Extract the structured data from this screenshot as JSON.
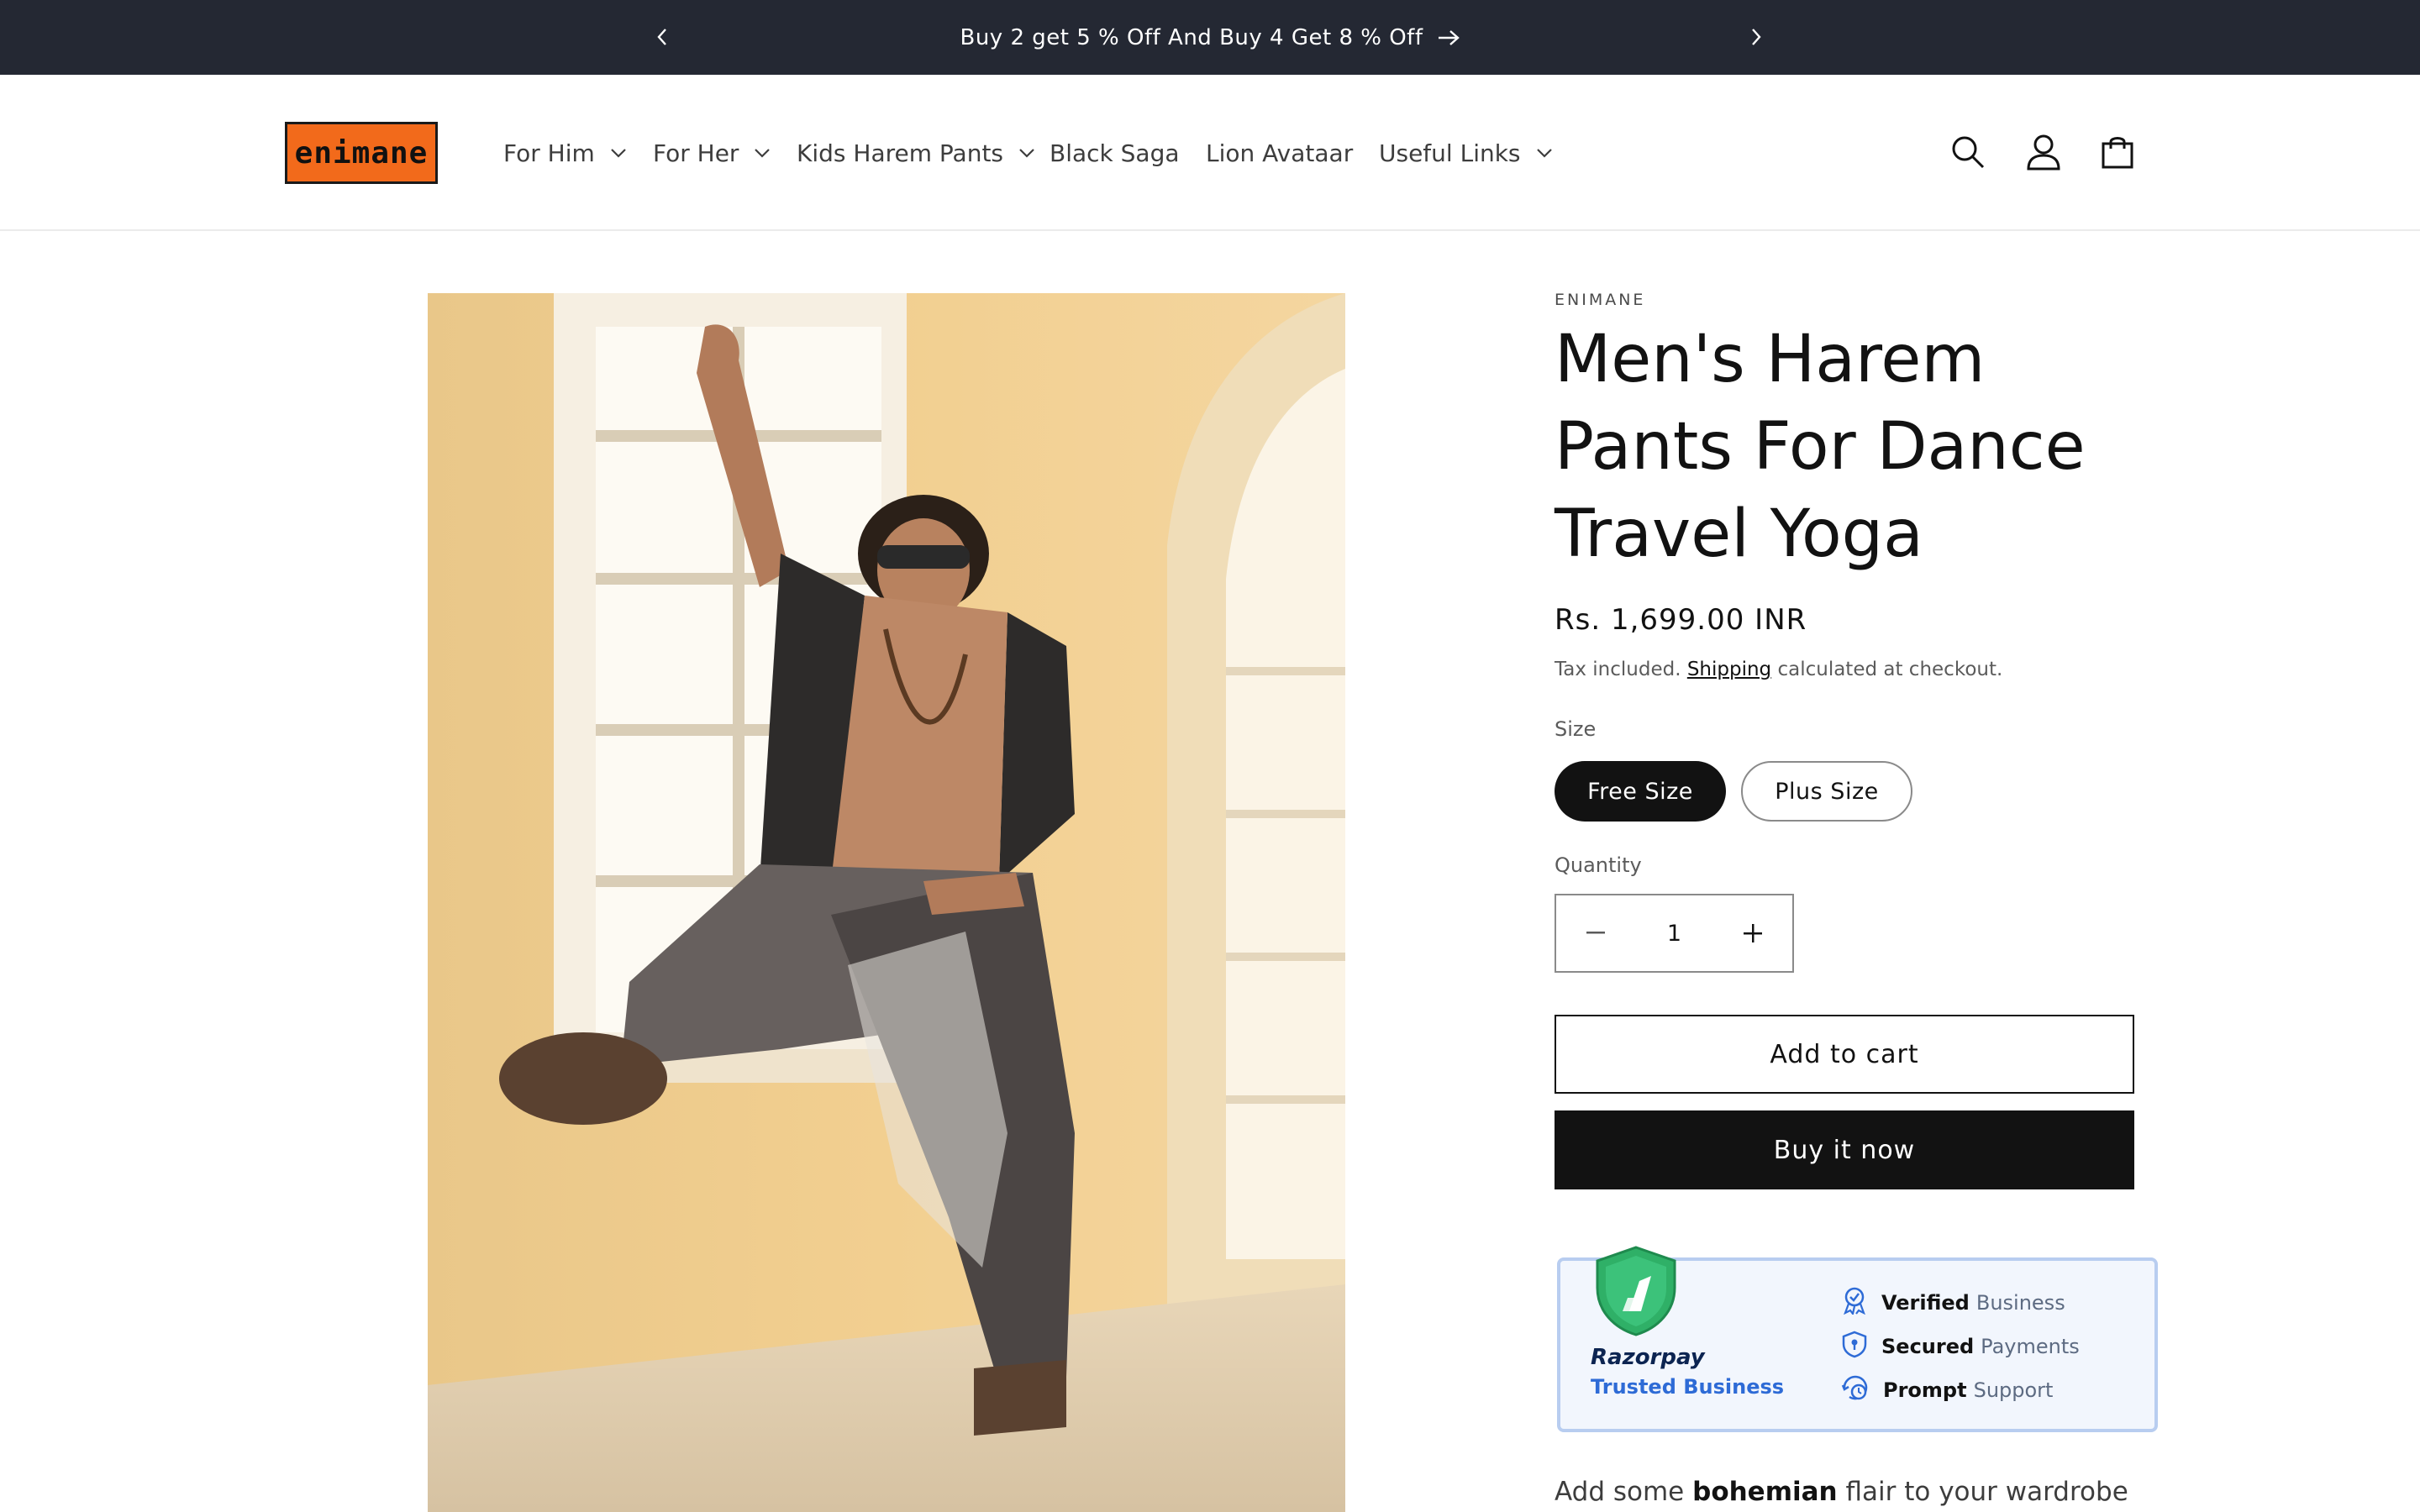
{
  "announcement": {
    "text": "Buy 2 get 5 % Off And Buy 4 Get 8 % Off"
  },
  "header": {
    "logo_text": "enimane",
    "nav": [
      {
        "label": "For Him",
        "has_dropdown": true
      },
      {
        "label": "For Her",
        "has_dropdown": true
      },
      {
        "label": "Kids Harem Pants",
        "has_dropdown": true
      },
      {
        "label": "Black Saga",
        "has_dropdown": false
      },
      {
        "label": "Lion Avataar",
        "has_dropdown": false
      },
      {
        "label": "Useful Links",
        "has_dropdown": true
      }
    ],
    "icons": [
      "search-icon",
      "account-icon",
      "cart-icon"
    ]
  },
  "product": {
    "vendor": "ENIMANE",
    "title": "Men's Harem Pants For Dance Travel Yoga",
    "price": "Rs. 1,699.00 INR",
    "tax_prefix": "Tax included.",
    "tax_link": "Shipping",
    "tax_suffix": "calculated at checkout.",
    "size_label": "Size",
    "sizes": [
      {
        "label": "Free Size",
        "selected": true
      },
      {
        "label": "Plus Size",
        "selected": false
      }
    ],
    "quantity_label": "Quantity",
    "quantity": "1",
    "add_to_cart": "Add to cart",
    "buy_now": "Buy it now"
  },
  "razorpay": {
    "brand": "Razorpay",
    "trusted": "Trusted Business",
    "features": [
      {
        "bold": "Verified",
        "rest": "Business",
        "icon": "verified-badge-icon"
      },
      {
        "bold": "Secured",
        "rest": "Payments",
        "icon": "secure-shield-icon"
      },
      {
        "bold": "Prompt",
        "rest": "Support",
        "icon": "support-clock-icon"
      }
    ]
  },
  "description": {
    "prefix": "Add some",
    "bold": "bohemian",
    "suffix": "flair to your wardrobe"
  },
  "colors": {
    "announcement_bg": "#242833",
    "logo_bg": "#f26a1b",
    "primary_button": "#121212",
    "razorpay_blue": "#2e6bd6",
    "shield_green": "#2fb067"
  }
}
